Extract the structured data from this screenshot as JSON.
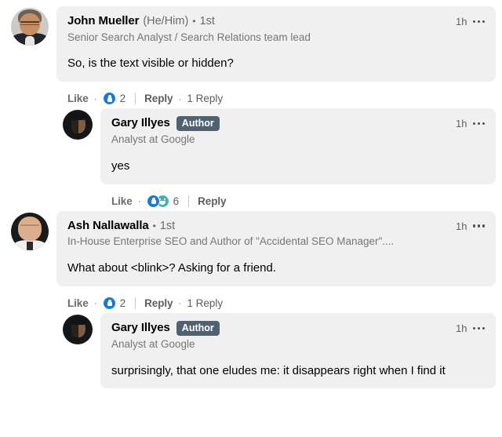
{
  "thread": {
    "comments": [
      {
        "level": 0,
        "avatar": "john-mueller-avatar",
        "name": "John Mueller",
        "pronouns": "(He/Him)",
        "separator": "•",
        "degree": "1st",
        "badge": "",
        "headline": "Senior Search Analyst / Search Relations team lead",
        "timestamp": "1h",
        "text": "So, is the text visible or hidden?",
        "actions": {
          "like_label": "Like",
          "dot": "·",
          "reactions": [
            "like"
          ],
          "reaction_count": "2",
          "reply_label": "Reply",
          "replies_label": "1 Reply"
        }
      },
      {
        "level": 1,
        "avatar": "gary-illyes-avatar",
        "name": "Gary Illyes",
        "pronouns": "",
        "separator": "",
        "degree": "",
        "badge": "Author",
        "headline": "Analyst at Google",
        "timestamp": "1h",
        "text": "yes",
        "actions": {
          "like_label": "Like",
          "dot": "·",
          "reactions": [
            "like",
            "funny"
          ],
          "reaction_count": "6",
          "reply_label": "Reply",
          "replies_label": ""
        }
      },
      {
        "level": 0,
        "avatar": "ash-nallawalla-avatar",
        "name": "Ash Nallawalla",
        "pronouns": "",
        "separator": "•",
        "degree": "1st",
        "badge": "",
        "headline": "In-House Enterprise SEO and Author of \"Accidental SEO Manager\"....",
        "timestamp": "1h",
        "text": "What about <blink>? Asking for a friend.",
        "actions": {
          "like_label": "Like",
          "dot": "·",
          "reactions": [
            "like"
          ],
          "reaction_count": "2",
          "reply_label": "Reply",
          "replies_label": "1 Reply"
        }
      },
      {
        "level": 1,
        "avatar": "gary-illyes-avatar",
        "name": "Gary Illyes",
        "pronouns": "",
        "separator": "",
        "degree": "",
        "badge": "Author",
        "headline": "Analyst at Google",
        "timestamp": "1h",
        "text": "surprisingly, that one eludes me: it disappears right when I find it",
        "actions": {
          "like_label": "",
          "dot": "",
          "reactions": [],
          "reaction_count": "",
          "reply_label": "",
          "replies_label": ""
        }
      }
    ]
  },
  "colors": {
    "bubble_background": "#f0f0f0",
    "page_background": "#ffffff",
    "author_badge": "#52616f",
    "reaction_like": "#1a7ad1",
    "reaction_funny": "#44b2ad",
    "secondary_text": "#6b6b6b"
  }
}
